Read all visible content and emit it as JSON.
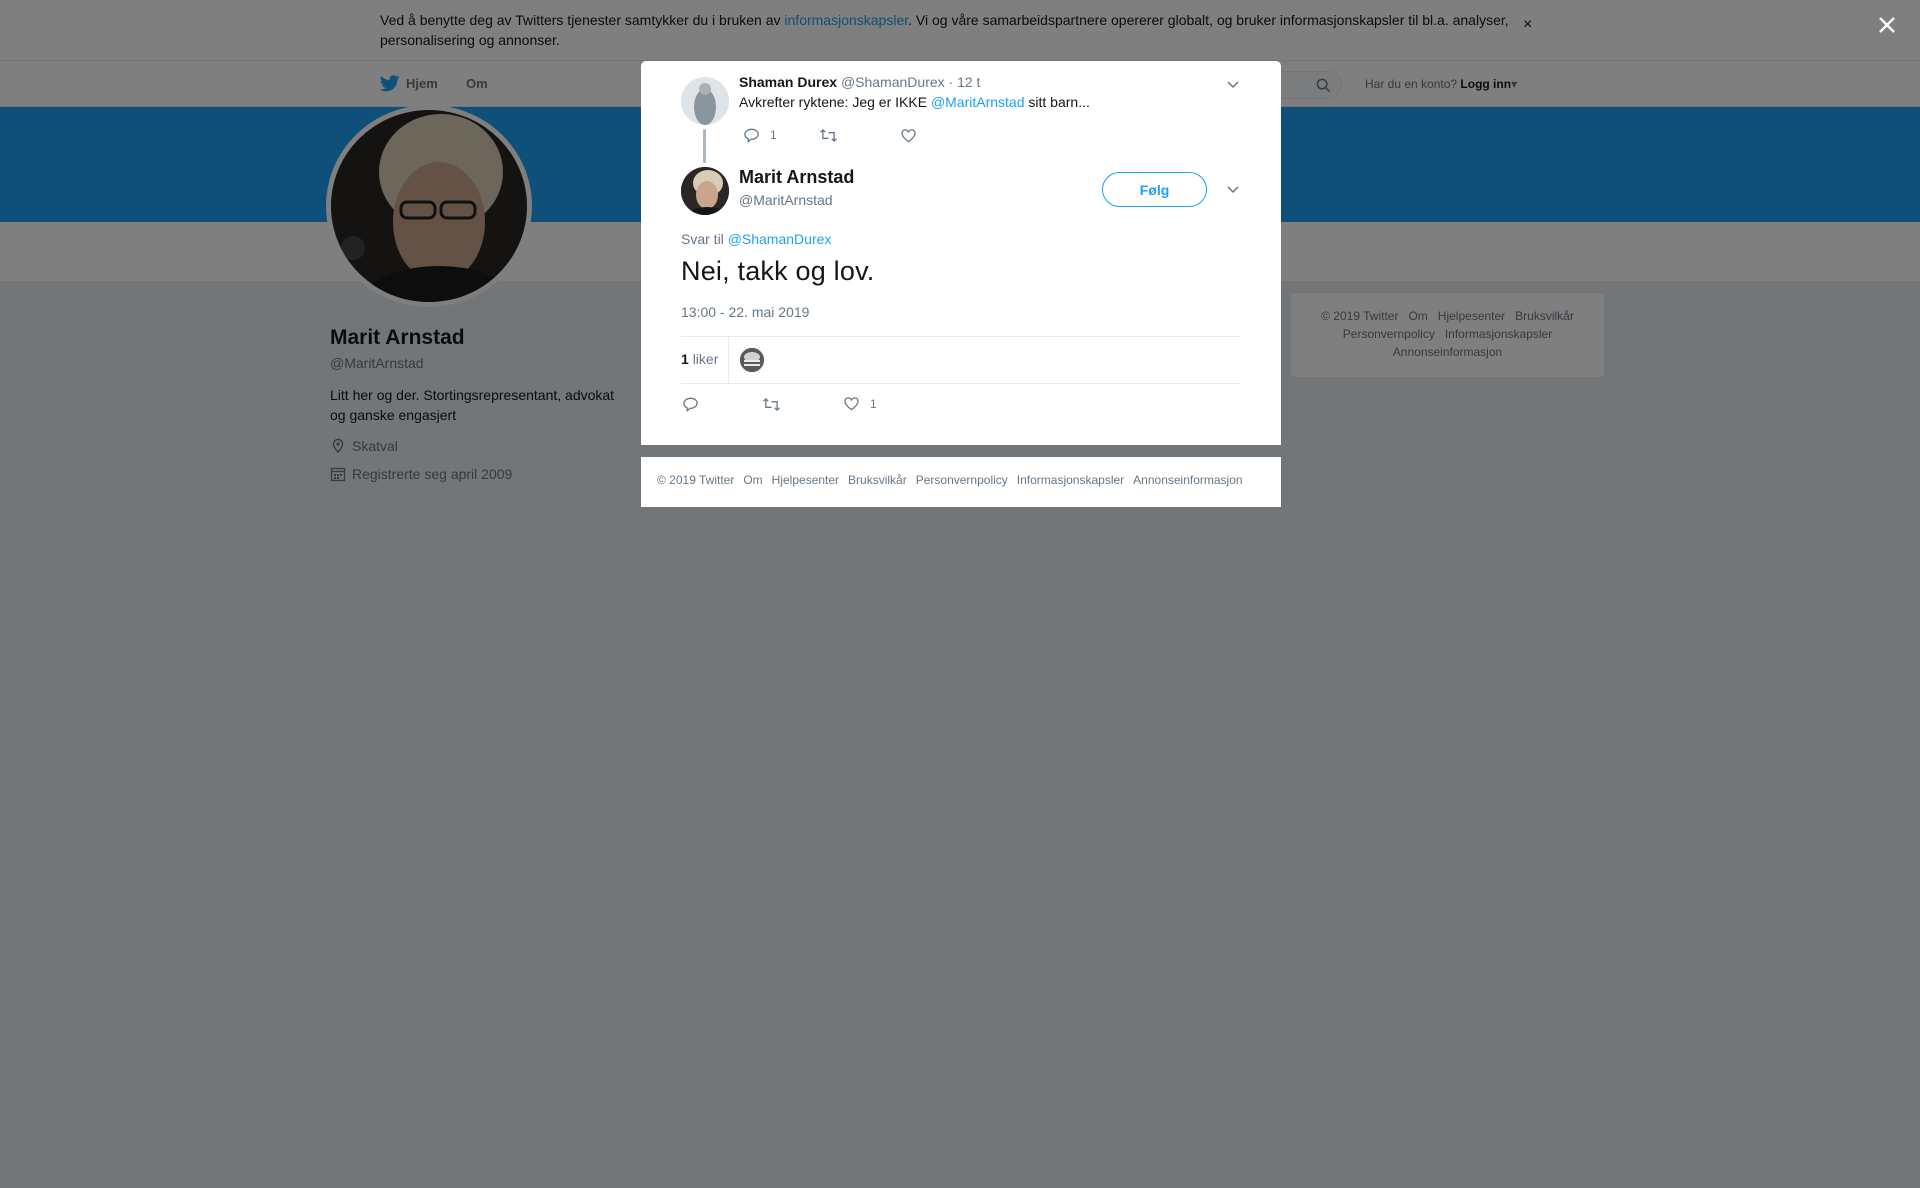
{
  "cookie_banner": {
    "text_before": "Ved å benytte deg av Twitters tjenester samtykker du i bruken av ",
    "link": "informasjonskapsler",
    "text_after": ". Vi og våre samarbeidspartnere opererer globalt, og bruker informasjonskapsler til bl.a. analyser, personalisering og annonser.",
    "close": "×"
  },
  "nav": {
    "home": "Hjem",
    "about": "Om",
    "login_prompt": "Har du en konto?",
    "login": "Logg inn"
  },
  "profile": {
    "name": "Marit Arnstad",
    "handle": "@MaritArnstad",
    "bio": "Litt her og der. Stortingsrepresentant, advokat og ganske engasjert",
    "location": "Skatval",
    "joined": "Registrerte seg april 2009"
  },
  "side_footer": [
    "© 2019 Twitter",
    "Om",
    "Hjelpesenter",
    "Bruksvilkår",
    "Personvernpolicy",
    "Informasjonskapsler",
    "Annonseinformasjon"
  ],
  "parent_tweet": {
    "name": "Shaman Durex",
    "handle": "@ShamanDurex",
    "time": "· 12 t",
    "text_before": "Avkrefter ryktene: Jeg er IKKE ",
    "mention": "@MaritArnstad",
    "text_after": " sitt barn...",
    "reply_count": "1"
  },
  "tweet": {
    "name": "Marit Arnstad",
    "handle": "@MaritArnstad",
    "follow": "Følg",
    "reply_prefix": "Svar til",
    "reply_to": "@ShamanDurex",
    "text": "Nei, takk og lov.",
    "timestamp": "13:00 - 22. mai 2019",
    "likes_count": "1",
    "likes_label": "liker",
    "like_action_count": "1"
  },
  "modal_footer": [
    "© 2019 Twitter",
    "Om",
    "Hjelpesenter",
    "Bruksvilkår",
    "Personvernpolicy",
    "Informasjonskapsler",
    "Annonseinformasjon"
  ],
  "colors": {
    "brand": "#1da1f2",
    "overlay": "rgba(0,0,0,0.5)"
  },
  "icons": [
    "twitter-bird-icon",
    "search-icon",
    "location-icon",
    "calendar-icon",
    "reply-icon",
    "retweet-icon",
    "heart-icon",
    "chevron-down-icon",
    "close-icon"
  ]
}
